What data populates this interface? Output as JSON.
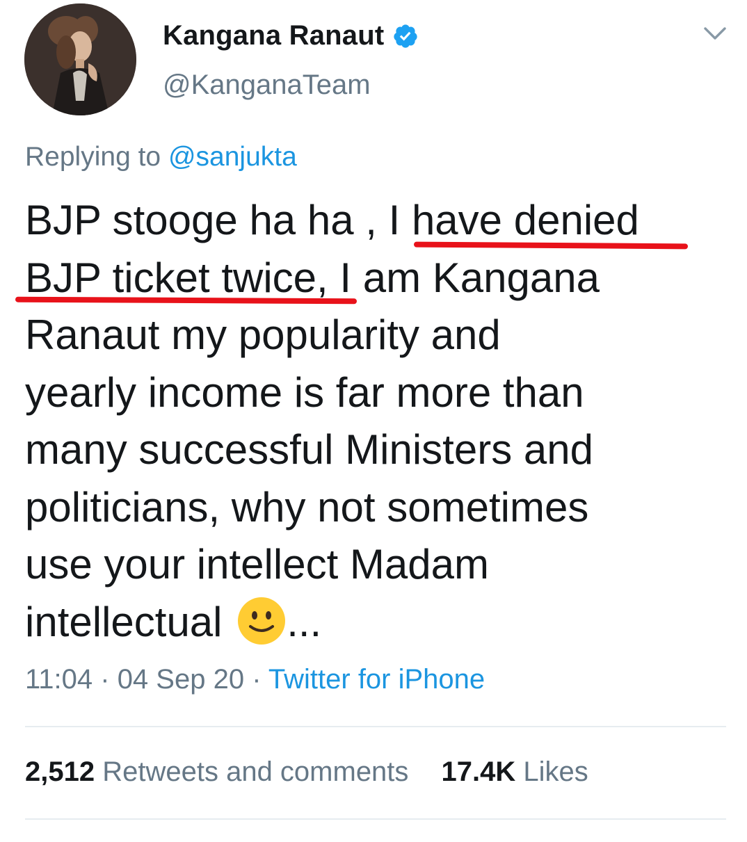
{
  "author": {
    "display_name": "Kangana Ranaut",
    "handle": "@KanganaTeam",
    "verified": true
  },
  "reply": {
    "prefix": "Replying to ",
    "mention": "@sanjukta"
  },
  "tweet": {
    "lines": [
      "BJP stooge ha ha , I have denied",
      "BJP ticket twice, I am Kangana",
      "Ranaut my popularity and",
      "yearly income is far more than",
      "many successful Ministers and",
      "politicians, why not sometimes",
      "use your intellect Madam",
      "intellectual",
      "..."
    ],
    "emoji": "slightly-smiling-face"
  },
  "meta": {
    "time": "11:04",
    "sep1": " · ",
    "date": "04 Sep 20",
    "sep2": " · ",
    "source": "Twitter for iPhone"
  },
  "stats": {
    "retweets_count": "2,512",
    "retweets_label": " Retweets and comments",
    "likes_count": "17.4K",
    "likes_label": " Likes"
  },
  "colors": {
    "text": "#14171a",
    "secondary": "#657786",
    "link": "#1b95e0",
    "verified": "#1da1f2",
    "underline_annotation": "#e8121a",
    "divider": "#e6ecf0",
    "emoji": "#ffcc33"
  }
}
